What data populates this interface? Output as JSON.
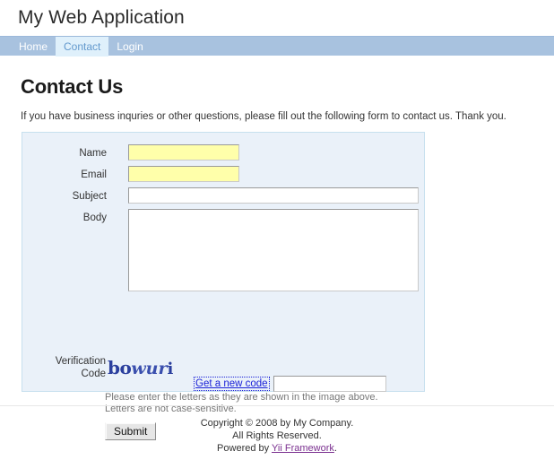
{
  "header": {
    "logo": "My Web Application"
  },
  "nav": {
    "items": [
      {
        "label": "Home",
        "active": false
      },
      {
        "label": "Contact",
        "active": true
      },
      {
        "label": "Login",
        "active": false
      }
    ]
  },
  "main": {
    "page_title": "Contact Us",
    "intro": "If you have business inquries or other questions, please fill out the following form to contact us. Thank you."
  },
  "form": {
    "fields": {
      "name": {
        "label": "Name",
        "value": "",
        "highlighted": true
      },
      "email": {
        "label": "Email",
        "value": "",
        "highlighted": true
      },
      "subject": {
        "label": "Subject",
        "value": "",
        "highlighted": false
      },
      "body": {
        "label": "Body",
        "value": "",
        "highlighted": false
      },
      "verify": {
        "label_line1": "Verification",
        "label_line2": "Code",
        "value": ""
      }
    },
    "captcha": {
      "text": "bowuri",
      "part_1": "bo",
      "part_2": "wur",
      "part_3": "i",
      "color": "#2b3f9e",
      "refresh_link": "Get a new code"
    },
    "hint_line1": "Please enter the letters as they are shown in the image above.",
    "hint_line2": "Letters are not case-sensitive.",
    "submit_label": "Submit",
    "panel_bg": "#eaf1f9",
    "highlight_bg": "#ffffaa"
  },
  "footer": {
    "line1": "Copyright © 2008 by My Company.",
    "line2": "All Rights Reserved.",
    "line3_prefix": "Powered by ",
    "link": "Yii Framework",
    "line3_suffix": "."
  }
}
